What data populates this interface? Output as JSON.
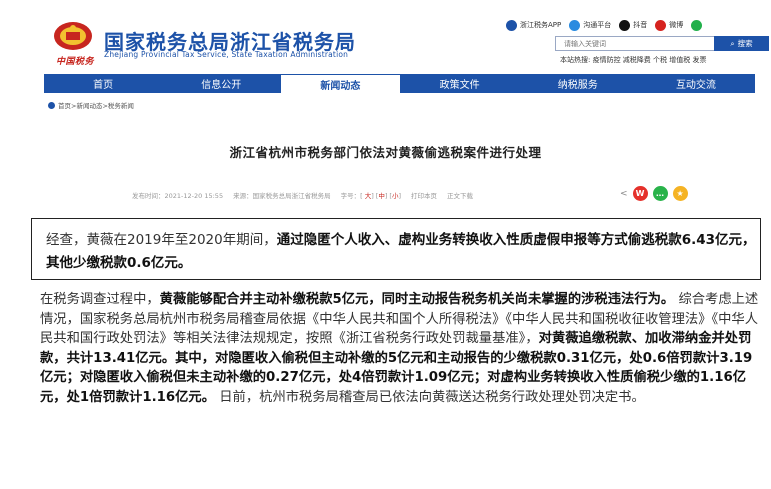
{
  "header": {
    "site_name_cn": "国家税务总局浙江省税务局",
    "site_name_en": "Zhejiang Provincial Tax Service, State Taxation Administration",
    "seal_text": "中国税务",
    "apps": [
      {
        "label": "浙江税务APP",
        "icon": "app-icon",
        "color": "#1d52a8"
      },
      {
        "label": "沟通平台",
        "icon": "cloud-icon",
        "color": "#2a8be0"
      },
      {
        "label": "抖音",
        "icon": "douyin-icon",
        "color": "#111111"
      },
      {
        "label": "微博",
        "icon": "weibo-icon",
        "color": "#d6231f"
      },
      {
        "label": "微信",
        "icon": "wechat-icon",
        "color": "#22b04b"
      }
    ],
    "search": {
      "placeholder": "请输入关键词",
      "button_label": "搜索"
    },
    "hot_search": "本站热搜:  疫情防控  减税降费  个税  增值税  发票"
  },
  "nav": {
    "items": [
      {
        "label": "首页"
      },
      {
        "label": "信息公开"
      },
      {
        "label": "新闻动态"
      },
      {
        "label": "政策文件"
      },
      {
        "label": "纳税服务"
      },
      {
        "label": "互动交流"
      }
    ],
    "active": "新闻动态"
  },
  "breadcrumb": "首页>新闻动态>税务新闻",
  "article": {
    "title": "浙江省杭州市税务部门依法对黄薇偷逃税案件进行处理",
    "meta": {
      "date": "发布时间：2021-12-20  15:55",
      "source": "来源：国家税务总局浙江省税务局",
      "font_label": "字号：",
      "size_large": "大",
      "size_medium": "中",
      "size_small": "小",
      "print": "打印本页",
      "fulltext": "正文下载"
    }
  },
  "summary": {
    "plain": "经查，黄薇在2019年至2020年期间，",
    "bold": "通过隐匿个人收入、虚构业务转换收入性质虚假申报等方式偷逃税款6.43亿元，其他少缴税款0.6亿元。"
  },
  "body": {
    "p1_plain": "在税务调查过程中，",
    "p1_bold": "黄薇能够配合并主动补缴税款5亿元，同时主动报告税务机关尚未掌握的涉税违法行为。",
    "p2_plain": "综合考虑上述情况，国家税务总局杭州市税务局稽查局依据《中华人民共和国个人所得税法》《中华人民共和国税收征收管理法》《中华人民共和国行政处罚法》等相关法律法规规定，按照《浙江省税务行政处罚裁量基准》，",
    "p2_bold": "对黄薇追缴税款、加收滞纳金并处罚款，共计13.41亿元。其中，对隐匿收入偷税但主动补缴的5亿元和主动报告的少缴税款0.31亿元，处0.6倍罚款计3.19亿元；对隐匿收入偷税但未主动补缴的0.27亿元，处4倍罚款计1.09亿元；对虚构业务转换收入性质偷税少缴的1.16亿元，处1倍罚款计1.16亿元。",
    "p3_plain": "日前，杭州市税务局稽查局已依法向黄薇送达税务行政处理处罚决定书。"
  }
}
